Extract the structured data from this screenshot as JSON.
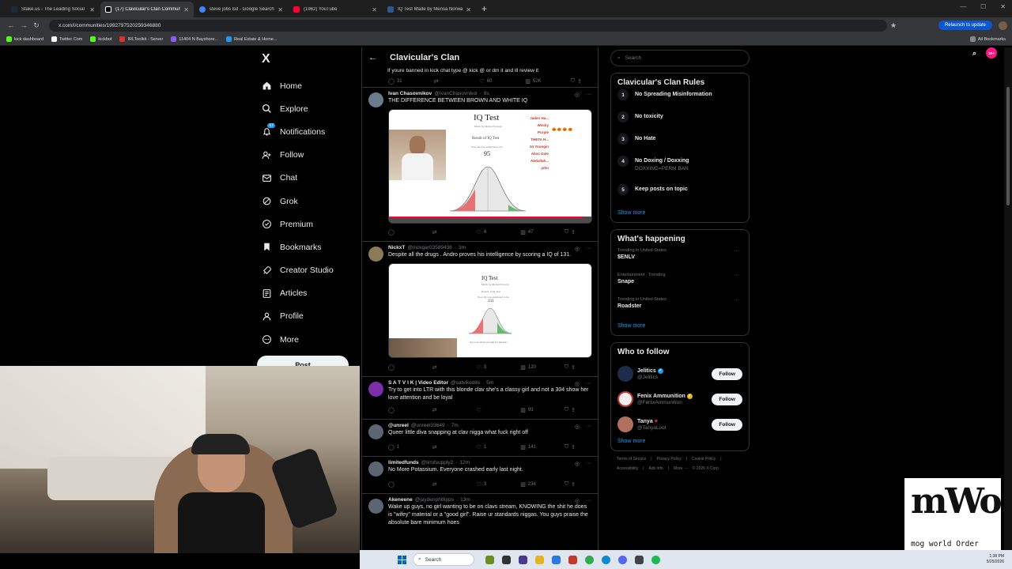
{
  "browser": {
    "tabs": [
      {
        "label": "Stake.us - The Leading Social C",
        "color": "#1a2c38",
        "active": false
      },
      {
        "label": "(17) Clavicular's Clan Commun",
        "color": "#000000",
        "active": true
      },
      {
        "label": "steve jobs lsd - Google Search",
        "color": "#4285f4",
        "active": false
      },
      {
        "label": "(1962) YouTube",
        "color": "#ff0033",
        "active": false
      },
      {
        "label": "IQ Test Made by Mensa Norwa",
        "color": "#2b5797",
        "active": false
      }
    ],
    "new_tab": "+",
    "url": "x.com/i/communities/1992797520259346880",
    "relaunch_label": "Relaunch to update",
    "bookmarks": [
      {
        "label": "kick dashboard",
        "color": "#53fc18"
      },
      {
        "label": "Twitter Com",
        "color": "#ffffff"
      },
      {
        "label": "kickbot",
        "color": "#53fc18"
      },
      {
        "label": "IRLToolkit - Server",
        "color": "#e03131"
      },
      {
        "label": "11404 N Bayshore...",
        "color": "#8b5cf6"
      },
      {
        "label": "Real Estate & Home...",
        "color": "#1d9bf0"
      }
    ],
    "all_bookmarks": "All Bookmarks"
  },
  "leftnav": {
    "logo": "X",
    "items": [
      {
        "label": "Home",
        "icon": "home-icon"
      },
      {
        "label": "Explore",
        "icon": "search-icon"
      },
      {
        "label": "Notifications",
        "icon": "bell-icon",
        "badge": "17"
      },
      {
        "label": "Follow",
        "icon": "follow-icon"
      },
      {
        "label": "Chat",
        "icon": "mail-icon"
      },
      {
        "label": "Grok",
        "icon": "grok-icon"
      },
      {
        "label": "Premium",
        "icon": "premium-icon"
      },
      {
        "label": "Bookmarks",
        "icon": "bookmark-icon"
      },
      {
        "label": "Creator Studio",
        "icon": "rocket-icon"
      },
      {
        "label": "Articles",
        "icon": "articles-icon"
      },
      {
        "label": "Profile",
        "icon": "profile-icon"
      },
      {
        "label": "More",
        "icon": "more-icon"
      }
    ],
    "post_label": "Post"
  },
  "center": {
    "title": "Clavicular's Clan",
    "notif_count": "20+",
    "top_peek": "If youre banned in kick chat type @ kick @ or dm it and ill review it",
    "top_actions": {
      "reply": "31",
      "retweet": "",
      "like": "60",
      "views": "52K"
    },
    "tweets": [
      {
        "name": "Ivan Chasovnikov",
        "handle": "@IvanChasovnikol",
        "time": "9s",
        "text": "THE DIFFERENCE BETWEEN BROWN AND WHITE IQ",
        "avatar_color": "#6b7b8c",
        "media": "iq1",
        "actions": {
          "reply": "",
          "retweet": "",
          "like": "4",
          "views": "47"
        }
      },
      {
        "name": "NickxT",
        "handle": "@nickgar03589436",
        "time": "3m",
        "text": "Despite all the drugs . Andro proves his intelligence by scoring a IQ of 131.",
        "avatar_color": "#8a7a5a",
        "media": "iq2",
        "actions": {
          "reply": "",
          "retweet": "",
          "like": "3",
          "views": "120"
        }
      },
      {
        "name": "S A T V I K | Video Editor",
        "handle": "@satvikedits",
        "time": "5m",
        "text": "Try to get into LTR with this blonde clav she's a classy girl and not a 304 show her love attention and be loyal",
        "avatar_color": "#7b2fa8",
        "media": "",
        "actions": {
          "reply": "",
          "retweet": "",
          "like": "",
          "views": "93"
        }
      },
      {
        "name": "@unreel",
        "handle": "@unreel33649",
        "time": "7m",
        "text": "Queer little diva snapping at clav nigga what fuck right off",
        "avatar_color": "#5b6670",
        "media": "",
        "actions": {
          "reply": "1",
          "retweet": "",
          "like": "1",
          "views": "141"
        }
      },
      {
        "name": "limitedfunds",
        "handle": "@limitsupply2",
        "time": "12m",
        "text": "No More Potassium. Everyone crashed early last night.",
        "avatar_color": "#5b6670",
        "media": "",
        "actions": {
          "reply": "",
          "retweet": "",
          "like": "3",
          "views": "234"
        }
      },
      {
        "name": "Akeneene",
        "handle": "@jaydenphillipps",
        "time": "13m",
        "text": "Wake up guys, no girl wanting to be on clavs stream, KNOWING the shit he does is \"wifey\" material or a \"good girl\". Raise ur standards niggas. You guys praise the absolute bare minimum hoes",
        "avatar_color": "#5b6670",
        "media": "",
        "actions": {
          "reply": "",
          "retweet": "",
          "like": "",
          "views": ""
        }
      }
    ],
    "iq1": {
      "title": "IQ Test",
      "subtitle": "Made by Mensa Norway",
      "result_label": "Result of IQ Test",
      "score_label": "Your IQ was estimated to be",
      "score": "95",
      "board": [
        "Jaden Ha...",
        "Wocky",
        "Purple",
        "THETA H...",
        "04 Youngin",
        "Alien Gate",
        "Abdullah...",
        "",
        "john"
      ],
      "board_tags": [
        "",
        "",
        "🎃 🎃 🎃 🎃",
        "",
        "",
        "",
        "",
        "",
        ""
      ]
    },
    "iq2": {
      "title": "IQ Test",
      "subtitle": "Made by Mensa Norway",
      "result_label": "Result of IQ Test",
      "score_label": "Your IQ was estimated to be",
      "score": "131",
      "footer_note": "Are you smart enough for Mensa?"
    }
  },
  "right": {
    "search_placeholder": "Search",
    "rules_title": "Clavicular's Clan Rules",
    "rules": [
      {
        "num": "1",
        "title": "No Spreading Misinformation",
        "sub": ""
      },
      {
        "num": "2",
        "title": "No toxicity",
        "sub": ""
      },
      {
        "num": "3",
        "title": "No Hate",
        "sub": ""
      },
      {
        "num": "4",
        "title": "No Doxing / Doxxing",
        "sub": "DOXXING=PERM BAN"
      },
      {
        "num": "5",
        "title": "Keep posts on topic",
        "sub": ""
      }
    ],
    "show_more": "Show more",
    "happening_title": "What's happening",
    "trends": [
      {
        "context": "Trending in United States",
        "name": "$ENLV"
      },
      {
        "context": "Entertainment · Trending",
        "name": "Snape"
      },
      {
        "context": "Trending in United States",
        "name": "Roadster"
      }
    ],
    "wtf_title": "Who to follow",
    "follow_label": "Follow",
    "who_to_follow": [
      {
        "name": "Jelitics",
        "handle": "@Jelitics",
        "badge": "blue",
        "avatar_color": "#1f2b4a"
      },
      {
        "name": "Fenix Ammunition",
        "handle": "@FenixAmmunition",
        "badge": "gold",
        "avatar_color": "#f0f0f0"
      },
      {
        "name": "Tanya",
        "handle": "@TanyaLoot",
        "badge": "heart",
        "avatar_color": "#b07060"
      }
    ],
    "footer": [
      "Terms of Service",
      "|",
      "Privacy Policy",
      "|",
      "Cookie Policy",
      "|",
      "Accessibility",
      "|",
      "Ads info",
      "|",
      "More ···",
      "© 2026 X Corp."
    ]
  },
  "watermark": {
    "big": "mWo",
    "small": "mog world Order"
  },
  "taskbar": {
    "search": "Search",
    "time": "1:38 PM",
    "date": "5/25/2026"
  }
}
